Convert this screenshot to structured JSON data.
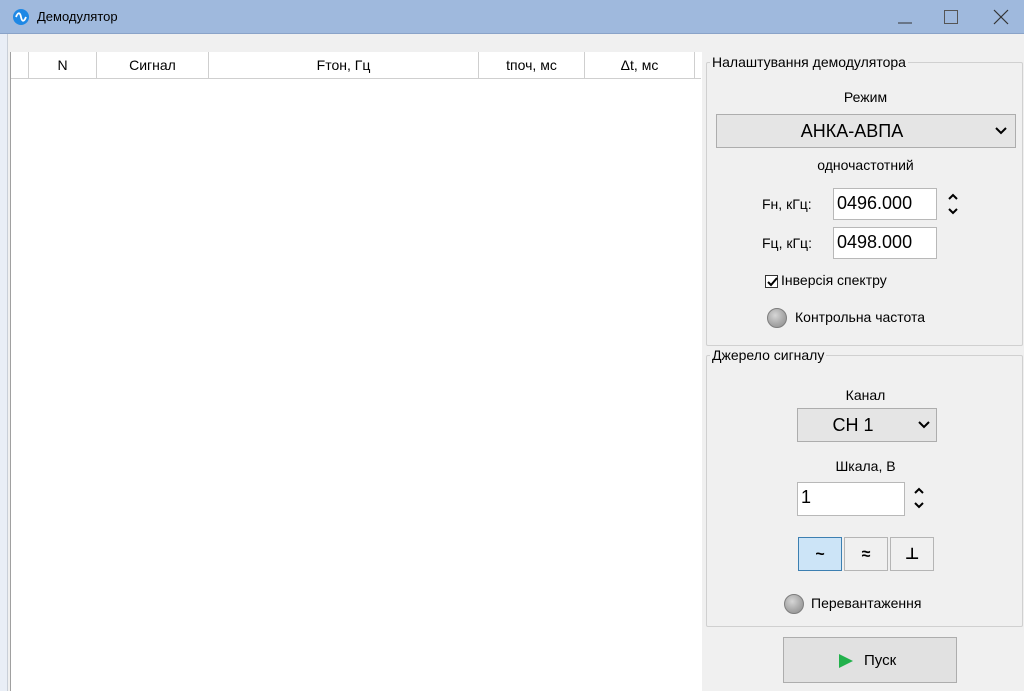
{
  "window": {
    "title": "Демодулятор",
    "controls": {
      "minimize": "minimize-icon",
      "maximize": "maximize-icon",
      "close": "close-icon"
    }
  },
  "table": {
    "columns": [
      "N",
      "Сигнал",
      "Fтон, Гц",
      "tпоч, мс",
      "Δt, мс"
    ],
    "rows": []
  },
  "demod_settings": {
    "legend": "Налаштування демодулятора",
    "mode_label": "Режим",
    "mode_value": "АНКА-АВПА",
    "mode_subtype": "одночастотний",
    "fn_label": "Fн, кГц:",
    "fn_value": "0496.000",
    "fc_label": "Fц, кГц:",
    "fc_value": "0498.000",
    "inversion_label": "Інверсія спектру",
    "inversion_checked": true,
    "control_freq_label": "Контрольна частота"
  },
  "signal_source": {
    "legend": "Джерело сигналу",
    "channel_label": "Канал",
    "channel_value": "CH 1",
    "scale_label": "Шкала, В",
    "scale_value": "1",
    "coupling": {
      "ac_symbol": "~",
      "dc_symbol": "≈",
      "gnd_symbol": "⊥",
      "selected": "ac"
    },
    "overload_label": "Перевантаження"
  },
  "start_button": {
    "label": "Пуск",
    "icon": "play-icon",
    "icon_color": "#22b14c"
  },
  "colors": {
    "titlebar": "#9fb9dd",
    "accent": "#1e88e5",
    "selected_toggle": "#cce4f7"
  }
}
